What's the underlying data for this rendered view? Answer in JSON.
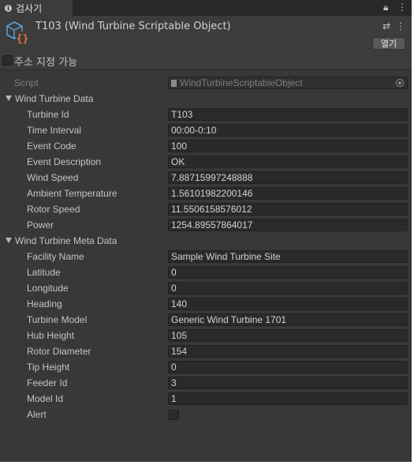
{
  "tab": {
    "label": "검사기"
  },
  "header": {
    "title": "T103 (Wind Turbine Scriptable Object)",
    "open_label": "열기"
  },
  "addressable": {
    "label": "주소 지정 가능",
    "checked": false
  },
  "script": {
    "label": "Script",
    "value": "WindTurbineScriptableObject"
  },
  "turbine_data": {
    "title": "Wind Turbine Data",
    "fields": [
      {
        "label": "Turbine Id",
        "value": "T103"
      },
      {
        "label": "Time Interval",
        "value": "00:00-0:10"
      },
      {
        "label": "Event Code",
        "value": "100"
      },
      {
        "label": "Event Description",
        "value": "OK"
      },
      {
        "label": "Wind Speed",
        "value": "7.88715997248888"
      },
      {
        "label": "Ambient Temperature",
        "value": "1.56101982200146"
      },
      {
        "label": "Rotor Speed",
        "value": "11.5506158576012"
      },
      {
        "label": "Power",
        "value": "1254.89557864017"
      }
    ]
  },
  "meta_data": {
    "title": "Wind Turbine Meta Data",
    "fields": [
      {
        "label": "Facility Name",
        "value": "Sample Wind Turbine Site"
      },
      {
        "label": "Latitude",
        "value": "0"
      },
      {
        "label": "Longitude",
        "value": "0"
      },
      {
        "label": "Heading",
        "value": "140"
      },
      {
        "label": "Turbine Model",
        "value": "Generic Wind Turbine 1701"
      },
      {
        "label": "Hub Height",
        "value": "105"
      },
      {
        "label": "Rotor Diameter",
        "value": "154"
      },
      {
        "label": "Tip Height",
        "value": "0"
      },
      {
        "label": "Feeder Id",
        "value": "3"
      },
      {
        "label": "Model Id",
        "value": "1"
      }
    ],
    "alert": {
      "label": "Alert",
      "checked": false
    }
  },
  "colors": {
    "panel_bg": "#383838",
    "header_bg": "#3c3c3c",
    "field_bg": "#2a2a2a",
    "text": "#c4c4c4",
    "accent_orange": "#e07a3a",
    "accent_blue": "#5aa0d8"
  }
}
